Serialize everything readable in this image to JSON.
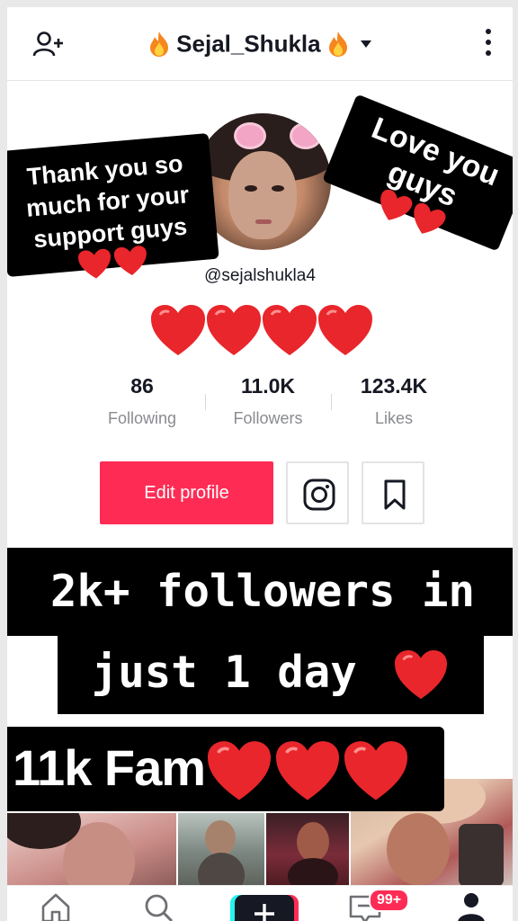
{
  "header": {
    "username": "Sejal_Shukla",
    "icons": {
      "add_user": "add-user-icon",
      "flame": "flame-emoji",
      "caret": "chevron-down-icon",
      "more": "more-vertical-icon"
    }
  },
  "profile": {
    "handle": "@sejalshukla4",
    "stats": [
      {
        "value": "86",
        "label": "Following"
      },
      {
        "value": "11.0K",
        "label": "Followers"
      },
      {
        "value": "123.4K",
        "label": "Likes"
      }
    ],
    "edit_label": "Edit profile"
  },
  "stickers": {
    "left_lines": [
      "Thank you so",
      "much for your",
      "support guys"
    ],
    "right_text": "Love you guys"
  },
  "banners": {
    "line1": "2k+ followers in",
    "line2": "just 1 day",
    "fam": "11k Fam"
  },
  "nav": {
    "inbox_badge": "99+"
  },
  "colors": {
    "accent": "#fe2c55",
    "heart": "#e8262b",
    "text": "#161823",
    "muted": "#8a8b91"
  }
}
